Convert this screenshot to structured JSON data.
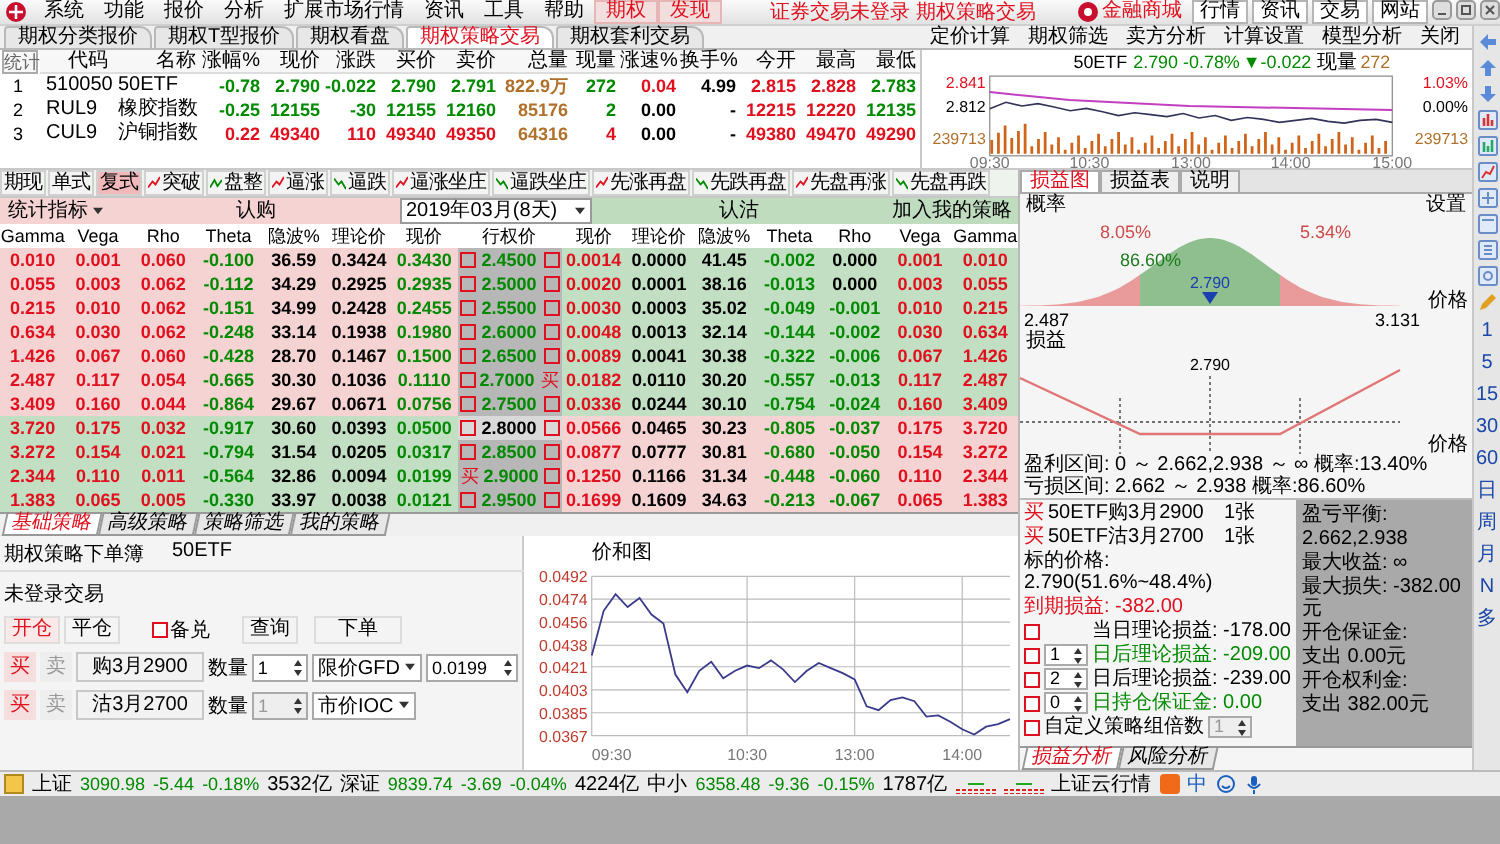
{
  "menu": {
    "items": [
      {
        "label": "系统",
        "highlight": false
      },
      {
        "label": "功能",
        "highlight": false
      },
      {
        "label": "报价",
        "highlight": false
      },
      {
        "label": "分析",
        "highlight": false
      },
      {
        "label": "扩展市场行情",
        "highlight": false
      },
      {
        "label": "资讯",
        "highlight": false
      },
      {
        "label": "工具",
        "highlight": false
      },
      {
        "label": "帮助",
        "highlight": false
      },
      {
        "label": "期权",
        "highlight": true
      },
      {
        "label": "发现",
        "highlight": true
      }
    ],
    "title": "证券交易未登录 期权策略交易",
    "mall": "金融商城",
    "buttons": [
      "行情",
      "资讯",
      "交易",
      "网站"
    ]
  },
  "tabs": [
    {
      "label": "期权分类报价",
      "selected": false
    },
    {
      "label": "期权T型报价",
      "selected": false
    },
    {
      "label": "期权看盘",
      "selected": false
    },
    {
      "label": "期权策略交易",
      "selected": true
    },
    {
      "label": "期权套利交易",
      "selected": false
    }
  ],
  "tools": [
    "定价计算",
    "期权筛选",
    "卖方分析",
    "计算设置",
    "模型分析",
    "关闭"
  ],
  "quotes": {
    "columns": [
      "统计",
      "代码",
      "名称",
      "涨幅%",
      "现价",
      "涨跌",
      "买价",
      "卖价",
      "总量",
      "现量",
      "涨速%",
      "换手%",
      "今开",
      "最高",
      "最低"
    ],
    "rows": [
      {
        "up": false,
        "cells": [
          "1",
          "510050",
          "50ETF",
          "-0.78",
          "2.790",
          "-0.022",
          "2.790",
          "2.791",
          "822.9万",
          "272",
          "0.04",
          "4.99",
          "2.815",
          "2.828",
          "2.783"
        ]
      },
      {
        "up": false,
        "cells": [
          "2",
          "RUL9",
          "橡胶指数",
          "-0.25",
          "12155",
          "-30",
          "12155",
          "12160",
          "85176",
          "2",
          "0.00",
          "-",
          "12215",
          "12220",
          "12135"
        ]
      },
      {
        "up": true,
        "cells": [
          "3",
          "CUL9",
          "沪铜指数",
          "0.22",
          "49340",
          "110",
          "49340",
          "49350",
          "64316",
          "4",
          "0.00",
          "-",
          "49380",
          "49470",
          "49290"
        ]
      }
    ]
  },
  "mini_chart": {
    "symbol": "50ETF",
    "price": "2.790",
    "pct": "-0.78%",
    "change": "▼-0.022",
    "vol_label": "现量",
    "vol": "272",
    "left_ticks": [
      "2.841",
      "2.812",
      "239713"
    ],
    "right_ticks": [
      "1.03%",
      "0.00%",
      "239713"
    ],
    "times": [
      "09:30",
      "10:30",
      "13:00",
      "14:00",
      "15:00"
    ]
  },
  "strategy_bar": [
    {
      "label": "期现",
      "kind": "tab",
      "selected": false
    },
    {
      "label": "单式",
      "kind": "tab",
      "selected": false
    },
    {
      "label": "复式",
      "kind": "tab",
      "selected": true
    },
    {
      "label": "突破",
      "kind": "rise"
    },
    {
      "label": "盘整",
      "kind": "flat"
    },
    {
      "label": "逼涨",
      "kind": "rise"
    },
    {
      "label": "逼跌",
      "kind": "fall"
    },
    {
      "label": "逼涨坐庄",
      "kind": "rise"
    },
    {
      "label": "逼跌坐庄",
      "kind": "fall"
    },
    {
      "label": "先涨再盘",
      "kind": "rise"
    },
    {
      "label": "先跌再盘",
      "kind": "fall"
    },
    {
      "label": "先盘再涨",
      "kind": "rise"
    },
    {
      "label": "先盘再跌",
      "kind": "fall"
    }
  ],
  "t_table": {
    "indicator": "统计指标",
    "call_label": "认购",
    "expiry": "2019年03月(8天)",
    "put_label": "认沽",
    "add_button": "加入我的策略",
    "columns": [
      {
        "label": "Gamma",
        "kind": "greek"
      },
      {
        "label": "Vega",
        "kind": "greek"
      },
      {
        "label": "Rho",
        "kind": "greek"
      },
      {
        "label": "Theta",
        "kind": "greek"
      },
      {
        "label": "隐波%",
        "kind": "plain"
      },
      {
        "label": "理论价",
        "kind": "plain"
      },
      {
        "label": "现价",
        "kind": "price"
      },
      {
        "label": "行权价",
        "kind": "strike"
      },
      {
        "label": "现价",
        "kind": "price"
      },
      {
        "label": "理论价",
        "kind": "plain"
      },
      {
        "label": "隐波%",
        "kind": "plain"
      },
      {
        "label": "Theta",
        "kind": "greek"
      },
      {
        "label": "Rho",
        "kind": "greek"
      },
      {
        "label": "Vega",
        "kind": "greek"
      },
      {
        "label": "Gamma",
        "kind": "greek"
      }
    ],
    "rows": [
      {
        "strike": "2.4500",
        "atm": false,
        "call_itm": true,
        "put_itm": false,
        "call_buy": false,
        "put_buy": false,
        "call": [
          "0.010",
          "0.001",
          "0.060",
          "-0.100",
          "36.59",
          "0.3424",
          "0.3430"
        ],
        "put": [
          "0.0014",
          "0.0000",
          "41.45",
          "-0.002",
          "0.000",
          "0.001",
          "0.010"
        ]
      },
      {
        "strike": "2.5000",
        "atm": false,
        "call_itm": true,
        "put_itm": false,
        "call_buy": false,
        "put_buy": false,
        "call": [
          "0.055",
          "0.003",
          "0.062",
          "-0.112",
          "34.29",
          "0.2925",
          "0.2935"
        ],
        "put": [
          "0.0020",
          "0.0001",
          "38.16",
          "-0.013",
          "0.000",
          "0.003",
          "0.055"
        ]
      },
      {
        "strike": "2.5500",
        "atm": false,
        "call_itm": true,
        "put_itm": false,
        "call_buy": false,
        "put_buy": false,
        "call": [
          "0.215",
          "0.010",
          "0.062",
          "-0.151",
          "34.99",
          "0.2428",
          "0.2455"
        ],
        "put": [
          "0.0030",
          "0.0003",
          "35.02",
          "-0.049",
          "-0.001",
          "0.010",
          "0.215"
        ]
      },
      {
        "strike": "2.6000",
        "atm": false,
        "call_itm": true,
        "put_itm": false,
        "call_buy": false,
        "put_buy": false,
        "call": [
          "0.634",
          "0.030",
          "0.062",
          "-0.248",
          "33.14",
          "0.1938",
          "0.1980"
        ],
        "put": [
          "0.0048",
          "0.0013",
          "32.14",
          "-0.144",
          "-0.002",
          "0.030",
          "0.634"
        ]
      },
      {
        "strike": "2.6500",
        "atm": false,
        "call_itm": true,
        "put_itm": false,
        "call_buy": false,
        "put_buy": false,
        "call": [
          "1.426",
          "0.067",
          "0.060",
          "-0.428",
          "28.70",
          "0.1467",
          "0.1500"
        ],
        "put": [
          "0.0089",
          "0.0041",
          "30.38",
          "-0.322",
          "-0.006",
          "0.067",
          "1.426"
        ]
      },
      {
        "strike": "2.7000",
        "atm": false,
        "call_itm": true,
        "put_itm": false,
        "call_buy": false,
        "put_buy": true,
        "put_mark": "买",
        "call": [
          "2.487",
          "0.117",
          "0.054",
          "-0.665",
          "30.30",
          "0.1036",
          "0.1110"
        ],
        "put": [
          "0.0182",
          "0.0110",
          "30.20",
          "-0.557",
          "-0.013",
          "0.117",
          "2.487"
        ]
      },
      {
        "strike": "2.7500",
        "atm": false,
        "call_itm": true,
        "put_itm": false,
        "call_buy": false,
        "put_buy": false,
        "call": [
          "3.409",
          "0.160",
          "0.044",
          "-0.864",
          "29.67",
          "0.0671",
          "0.0756"
        ],
        "put": [
          "0.0336",
          "0.0244",
          "30.10",
          "-0.754",
          "-0.024",
          "0.160",
          "3.409"
        ]
      },
      {
        "strike": "2.8000",
        "atm": true,
        "call_itm": false,
        "put_itm": true,
        "call_buy": false,
        "put_buy": false,
        "call": [
          "3.720",
          "0.175",
          "0.032",
          "-0.917",
          "30.60",
          "0.0393",
          "0.0500"
        ],
        "put": [
          "0.0566",
          "0.0465",
          "30.23",
          "-0.805",
          "-0.037",
          "0.175",
          "3.720"
        ]
      },
      {
        "strike": "2.8500",
        "atm": false,
        "call_itm": false,
        "put_itm": true,
        "call_buy": false,
        "put_buy": false,
        "call": [
          "3.272",
          "0.154",
          "0.021",
          "-0.794",
          "31.54",
          "0.0205",
          "0.0317"
        ],
        "put": [
          "0.0877",
          "0.0777",
          "30.81",
          "-0.680",
          "-0.050",
          "0.154",
          "3.272"
        ]
      },
      {
        "strike": "2.9000",
        "atm": false,
        "call_itm": false,
        "put_itm": true,
        "call_buy": true,
        "put_buy": false,
        "call_mark": "买",
        "call": [
          "2.344",
          "0.110",
          "0.011",
          "-0.564",
          "32.86",
          "0.0094",
          "0.0199"
        ],
        "put": [
          "0.1250",
          "0.1166",
          "31.34",
          "-0.448",
          "-0.060",
          "0.110",
          "2.344"
        ]
      },
      {
        "strike": "2.9500",
        "atm": false,
        "call_itm": false,
        "put_itm": true,
        "call_buy": false,
        "put_buy": false,
        "call": [
          "1.383",
          "0.065",
          "0.005",
          "-0.330",
          "33.97",
          "0.0038",
          "0.0121"
        ],
        "put": [
          "0.1699",
          "0.1609",
          "34.63",
          "-0.213",
          "-0.067",
          "0.065",
          "1.383"
        ]
      }
    ]
  },
  "order_tabs": [
    {
      "label": "基础策略",
      "selected": true
    },
    {
      "label": "高级策略",
      "selected": false
    },
    {
      "label": "策略筛选",
      "selected": false
    },
    {
      "label": "我的策略",
      "selected": false
    }
  ],
  "order": {
    "title": "期权策略下单簿",
    "symbol": "50ETF",
    "login": "未登录交易",
    "modes": [
      {
        "label": "开仓",
        "selected": true
      },
      {
        "label": "平仓",
        "selected": false
      }
    ],
    "covered": {
      "label": "备兑",
      "checked": false
    },
    "query": "查询",
    "submit": "下单",
    "legs": [
      {
        "sides": [
          {
            "label": "买",
            "selected": true
          },
          {
            "label": "卖",
            "selected": false
          }
        ],
        "contract": "购3月2900",
        "qty_label": "数量",
        "qty": "1",
        "qty_disabled": false,
        "type": "限价GFD",
        "price": "0.0199"
      },
      {
        "sides": [
          {
            "label": "买",
            "selected": true
          },
          {
            "label": "卖",
            "selected": false
          }
        ],
        "contract": "沽3月2700",
        "qty_label": "数量",
        "qty": "1",
        "qty_disabled": true,
        "type": "市价IOC"
      }
    ]
  },
  "price_chart": {
    "title": "价和图",
    "times": [
      "09:30",
      "10:30",
      "13:00",
      "14:00"
    ],
    "chart_data": {
      "type": "line",
      "grid": true,
      "ylim": [
        0.0367,
        0.0492
      ],
      "yticks": [
        {
          "value": 0.0492,
          "label": "0.0492"
        },
        {
          "value": 0.0474,
          "label": "0.0474"
        },
        {
          "value": 0.0456,
          "label": "0.0456"
        },
        {
          "value": 0.0438,
          "label": "0.0438"
        },
        {
          "value": 0.0421,
          "label": "0.0421"
        },
        {
          "value": 0.0403,
          "label": "0.0403"
        },
        {
          "value": 0.0385,
          "label": "0.0385"
        },
        {
          "value": 0.0367,
          "label": "0.0367"
        }
      ],
      "series": [
        {
          "color": "#3a3a8c",
          "values": [
            0.043,
            0.0465,
            0.0478,
            0.0468,
            0.0475,
            0.0462,
            0.0455,
            0.0415,
            0.0401,
            0.0418,
            0.0425,
            0.0412,
            0.0418,
            0.0422,
            0.042,
            0.0426,
            0.0419,
            0.0409,
            0.0418,
            0.0424,
            0.042,
            0.0416,
            0.0411,
            0.039,
            0.0387,
            0.0395,
            0.0397,
            0.0394,
            0.0382,
            0.0383,
            0.0378,
            0.0372,
            0.0368,
            0.0374,
            0.0376,
            0.038
          ]
        }
      ]
    }
  },
  "analysis": {
    "tabs": [
      {
        "label": "损益图",
        "selected": true
      },
      {
        "label": "损益表",
        "selected": false
      },
      {
        "label": "说明",
        "selected": false
      }
    ],
    "prob_label": "概率",
    "settings": "设置",
    "left_pct": "8.05%",
    "mid_pct": "86.60%",
    "right_pct": "5.34%",
    "price_marker": "2.790",
    "price_axis": "价格",
    "low": "2.487",
    "high": "3.131",
    "pnl_label": "损益",
    "pnl_price": "2.790",
    "pnl_axis": "价格",
    "profit_range": "盈利区间: 0 ～ 2.662,2.938 ～ ∞  概率:13.40%",
    "loss_range": "亏损区间: 2.662 ～ 2.938  概率:86.60%",
    "legs": [
      {
        "side": "买",
        "name": "50ETF购3月2900",
        "qty": "1张"
      },
      {
        "side": "买",
        "name": "50ETF沽3月2700",
        "qty": "1张"
      }
    ],
    "underlying": "标的价格: 2.790(51.6%~48.4%)",
    "expiry_pnl": "到期损益: -382.00",
    "options": [
      {
        "kind": "plain",
        "checked": false,
        "text": "当日理论损益: -178.00",
        "highlight": false
      },
      {
        "kind": "spin",
        "value": "1",
        "checked": false,
        "text": "日后理论损益: -209.00",
        "highlight": true
      },
      {
        "kind": "spin",
        "value": "2",
        "checked": false,
        "text": "日后理论损益: -239.00",
        "highlight": false
      },
      {
        "kind": "spin",
        "value": "0",
        "checked": false,
        "text": "日持仓保证金: 0.00",
        "highlight": true
      }
    ],
    "multiplier_checked": false,
    "multiplier_label": "自定义策略组倍数",
    "multiplier": "1",
    "summary": [
      "盈亏平衡:",
      "2.662,2.938",
      "最大收益: ∞",
      "最大损失: -382.00元",
      "开仓保证金:",
      "支出 0.00元",
      "开仓权利金:",
      "支出 382.00元"
    ],
    "bottom_tabs": [
      {
        "label": "损益分析",
        "selected": true
      },
      {
        "label": "风险分析",
        "selected": false
      }
    ]
  },
  "side_periods": [
    "1",
    "5",
    "15",
    "30",
    "60",
    "日",
    "周",
    "月",
    "N",
    "多"
  ],
  "status": {
    "indices": [
      {
        "name": "上证",
        "value": "3090.98",
        "change": "-5.44",
        "pct": "-0.18%",
        "amount": "3532亿"
      },
      {
        "name": "深证",
        "value": "9839.74",
        "change": "-3.69",
        "pct": "-0.04%",
        "amount": "4224亿"
      },
      {
        "name": "中小",
        "value": "6358.48",
        "change": "-9.36",
        "pct": "-0.15%",
        "amount": "1787亿"
      }
    ],
    "cloud": "上证云行情",
    "ime": "中"
  }
}
